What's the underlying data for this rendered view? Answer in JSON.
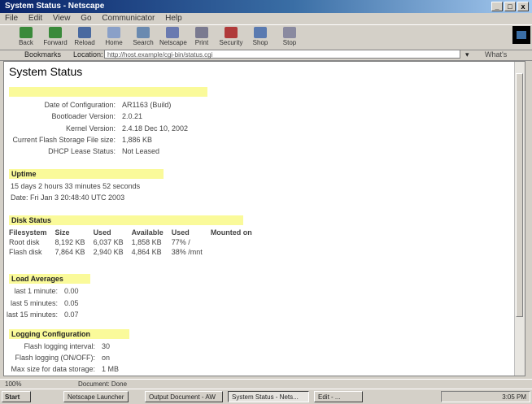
{
  "window": {
    "title": "System Status - Netscape",
    "controls": [
      "_",
      "□",
      "x"
    ]
  },
  "menu": [
    "File",
    "Edit",
    "View",
    "Go",
    "Communicator",
    "Help"
  ],
  "toolbar": [
    {
      "label": "Back",
      "icon": "back-icon",
      "color": "#3a8a3a"
    },
    {
      "label": "Forward",
      "icon": "forward-icon",
      "color": "#3a8a3a"
    },
    {
      "label": "Reload",
      "icon": "reload-icon",
      "color": "#4a6aa0"
    },
    {
      "label": "Home",
      "icon": "home-icon",
      "color": "#8aa0c8"
    },
    {
      "label": "Search",
      "icon": "search-icon",
      "color": "#6a8ab0"
    },
    {
      "label": "Netscape",
      "icon": "netscape-icon",
      "color": "#6a7ab0"
    },
    {
      "label": "Print",
      "icon": "print-icon",
      "color": "#7a7a90"
    },
    {
      "label": "Security",
      "icon": "security-icon",
      "color": "#b03a3a"
    },
    {
      "label": "Shop",
      "icon": "shop-icon",
      "color": "#5a7ab0"
    },
    {
      "label": "Stop",
      "icon": "stop-icon",
      "color": "#8a8aa0"
    }
  ],
  "address": {
    "bookmarks_label": "Bookmarks",
    "location_label": "Location:",
    "url": "http://host.example/cgi-bin/status.cgi",
    "whats_related": "What's Related"
  },
  "page": {
    "title": "System Status",
    "version": {
      "rows": [
        {
          "key": "Date of Configuration:",
          "value": "AR1163 (Build)"
        },
        {
          "key": "Bootloader Version:",
          "value": "2.0.21"
        },
        {
          "key": "Kernel Version:",
          "value": "2.4.18 Dec 10, 2002"
        },
        {
          "key": "Current Flash Storage File size:",
          "value": "1,886 KB"
        },
        {
          "key": "DHCP Lease Status:",
          "value": "Not Leased"
        }
      ]
    },
    "uptime": {
      "header": "Uptime",
      "line1": "15 days  2 hours  33 minutes  52 seconds",
      "line2": "Date: Fri Jan 3 20:48:40 UTC 2003"
    },
    "disk": {
      "header": "Disk Status",
      "columns": [
        "Filesystem",
        "Size",
        "Used",
        "Available",
        "Used",
        "Mounted on"
      ],
      "rows": [
        [
          "Root disk",
          "8,192 KB",
          "6,037 KB",
          "1,858 KB",
          "77% /",
          ""
        ],
        [
          "Flash disk",
          "7,864 KB",
          "2,940 KB",
          "4,864 KB",
          "38% /mnt",
          ""
        ]
      ]
    },
    "load": {
      "header": "Load Averages",
      "rows": [
        {
          "key": "last 1 minute:",
          "value": "0.00"
        },
        {
          "key": "last 5 minutes:",
          "value": "0.05"
        },
        {
          "key": "last 15 minutes:",
          "value": "0.07"
        }
      ]
    },
    "logging": {
      "header": "Logging Configuration",
      "rows": [
        {
          "key": "Flash logging interval:",
          "value": "30"
        },
        {
          "key": "Flash logging (ON/OFF):",
          "value": "on"
        },
        {
          "key": "Max size for data storage:",
          "value": "1 MB"
        }
      ]
    }
  },
  "status": {
    "left": "100%",
    "middle": "Document: Done",
    "right": ""
  },
  "taskbar": {
    "start": "Start",
    "tasks": [
      {
        "label": "Netscape Launcher",
        "active": false
      },
      {
        "label": "Output Document - AW",
        "active": false
      },
      {
        "label": "System Status - Nets...",
        "active": true
      },
      {
        "label": "Edit - ...",
        "active": false
      }
    ],
    "clock": "3:05 PM"
  }
}
